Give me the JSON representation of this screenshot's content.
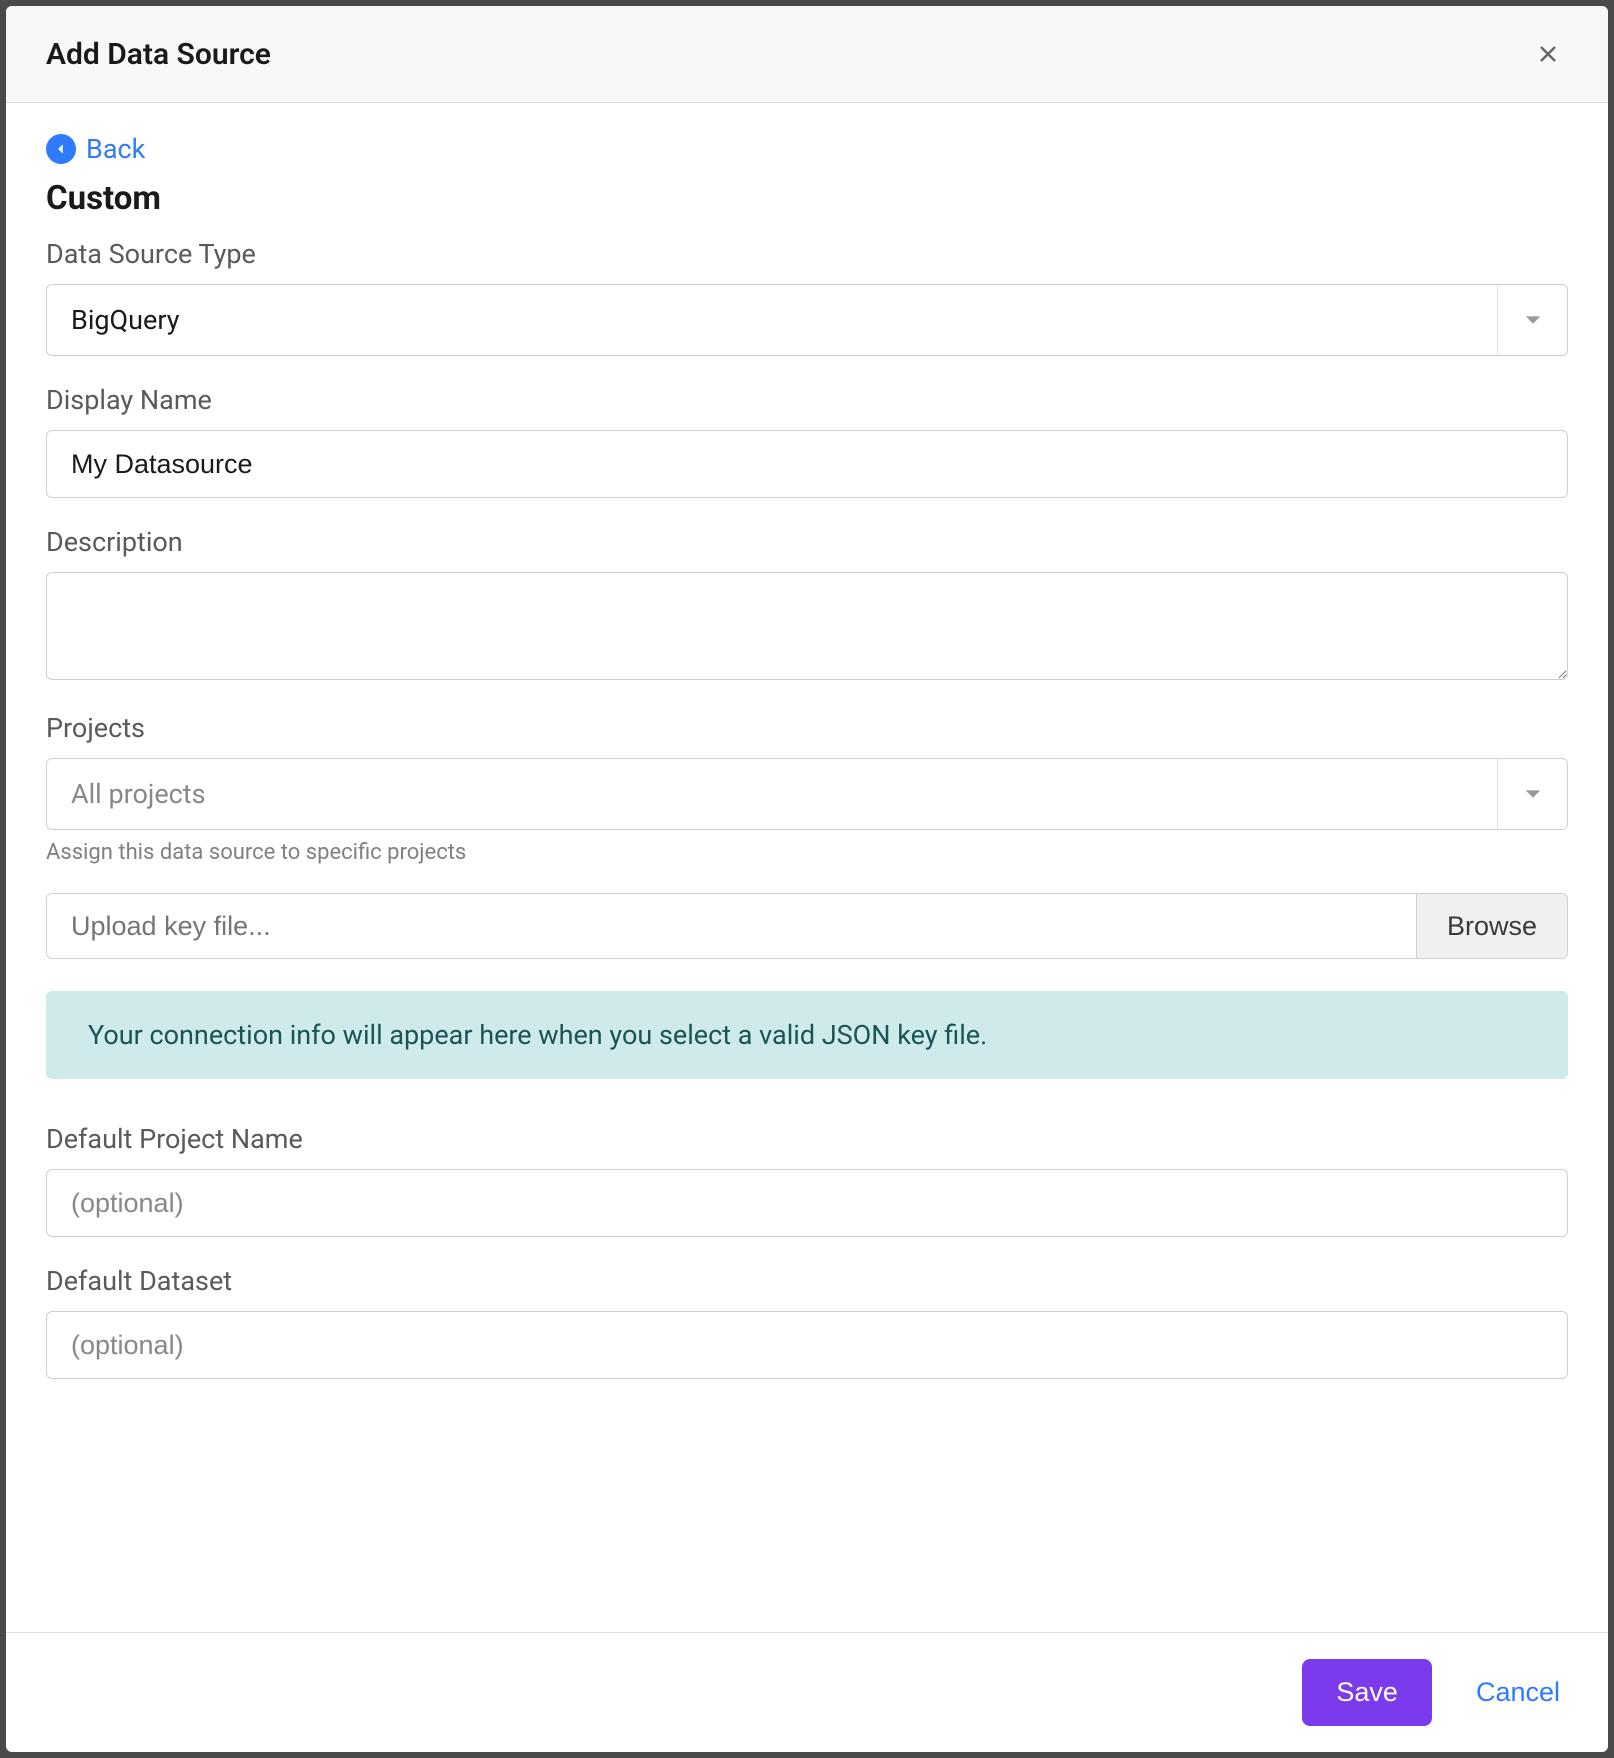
{
  "modal": {
    "title": "Add Data Source"
  },
  "nav": {
    "back_label": "Back"
  },
  "section": {
    "title": "Custom"
  },
  "form": {
    "data_source_type": {
      "label": "Data Source Type",
      "value": "BigQuery"
    },
    "display_name": {
      "label": "Display Name",
      "value": "My Datasource"
    },
    "description": {
      "label": "Description",
      "value": ""
    },
    "projects": {
      "label": "Projects",
      "placeholder": "All projects",
      "help": "Assign this data source to specific projects"
    },
    "key_file": {
      "placeholder": "Upload key file...",
      "browse_label": "Browse"
    },
    "info_banner": {
      "text": "Your connection info will appear here when you select a valid JSON key file."
    },
    "default_project_name": {
      "label": "Default Project Name",
      "placeholder": "(optional)"
    },
    "default_dataset": {
      "label": "Default Dataset",
      "placeholder": "(optional)"
    }
  },
  "footer": {
    "save_label": "Save",
    "cancel_label": "Cancel"
  }
}
